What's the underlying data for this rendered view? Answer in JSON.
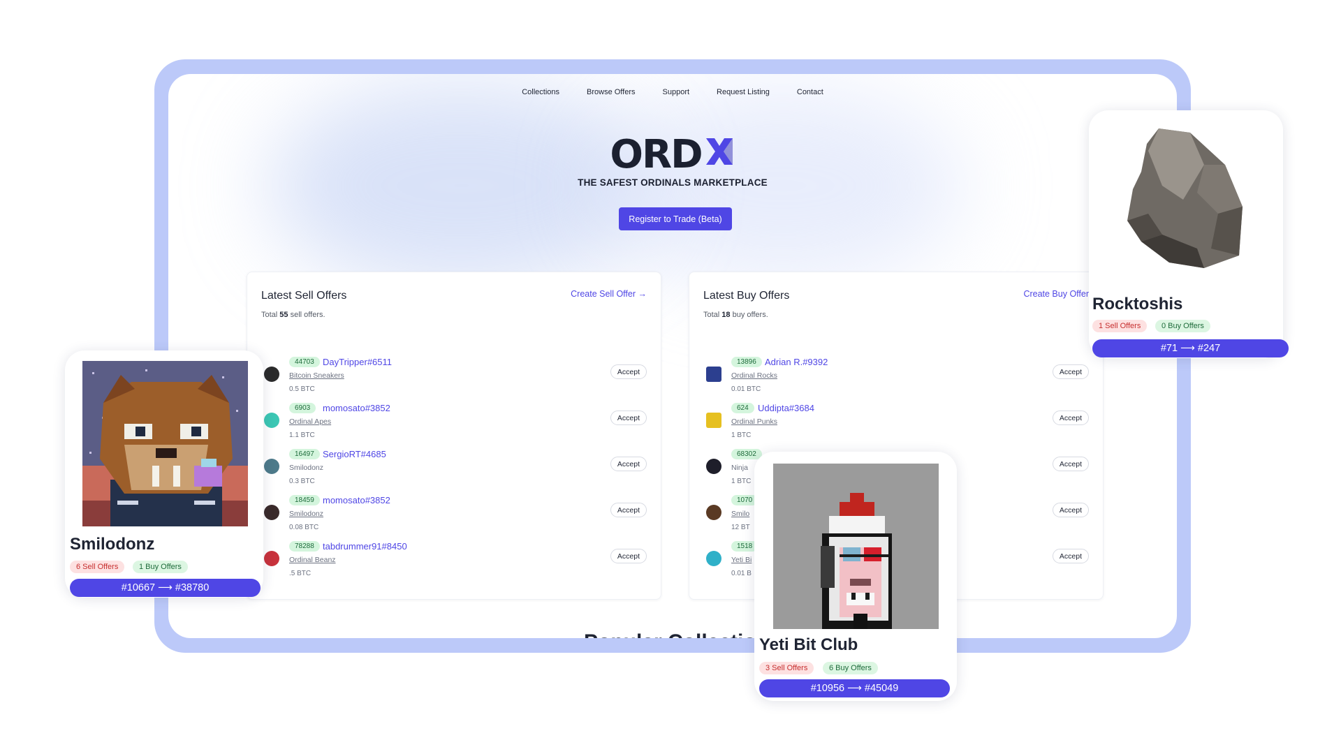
{
  "nav": {
    "items": [
      "Collections",
      "Browse Offers",
      "Support",
      "Request Listing",
      "Contact"
    ]
  },
  "hero": {
    "logo_text": "ORD",
    "tagline": "THE SAFEST ORDINALS MARKETPLACE",
    "cta_label": "Register to Trade (Beta)"
  },
  "sell": {
    "title": "Latest Sell Offers",
    "create_label": "Create Sell Offer →",
    "total_prefix": "Total ",
    "total_count": "55",
    "total_suffix": " sell offers.",
    "rows": [
      {
        "id": "44703",
        "name": "DayTripper#6511",
        "collection": "Bitcoin Sneakers",
        "price": "0.5 BTC",
        "accept": "Accept",
        "avatar_color": "#2b2b2b"
      },
      {
        "id": "6903",
        "name": "momosato#3852",
        "collection": "Ordinal Apes",
        "price": "1.1 BTC",
        "accept": "Accept",
        "avatar_color": "#3cc7b4"
      },
      {
        "id": "16497",
        "name": "SergioRT#4685",
        "collection": "Smilodonz",
        "price": "0.3 BTC",
        "accept": "Accept",
        "avatar_color": "#4d7a8a"
      },
      {
        "id": "18459",
        "name": "momosato#3852",
        "collection": "Smilodonz",
        "price": "0.08 BTC",
        "accept": "Accept",
        "avatar_color": "#3a2a2a"
      },
      {
        "id": "78288",
        "name": "tabdrummer91#8450",
        "collection": "Ordinal Beanz",
        "price": ".5 BTC",
        "accept": "Accept",
        "avatar_color": "#c8323c"
      }
    ]
  },
  "buy": {
    "title": "Latest Buy Offers",
    "create_label": "Create Buy Offer",
    "total_prefix": "Total ",
    "total_count": "18",
    "total_suffix": " buy offers.",
    "rows": [
      {
        "id": "13896",
        "name": "Adrian R.#9392",
        "collection": "Ordinal Rocks",
        "price": "0.01 BTC",
        "accept": "Accept",
        "avatar_color": "#2c3f8f"
      },
      {
        "id": "624",
        "name": "Uddipta#3684",
        "collection": "Ordinal Punks",
        "price": "1 BTC",
        "accept": "Accept",
        "avatar_color": "#e6c020"
      },
      {
        "id": "68302",
        "name": "",
        "collection": "Ninja",
        "price": "1 BTC",
        "accept": "Accept",
        "avatar_color": "#1e1e2a"
      },
      {
        "id": "1070",
        "name": "",
        "collection": "Smilo",
        "price": "12 BT",
        "accept": "Accept",
        "avatar_color": "#5a3a24"
      },
      {
        "id": "1518",
        "name": "",
        "collection": "Yeti Bi",
        "price": "0.01 B",
        "accept": "Accept",
        "avatar_color": "#2fb0c8"
      }
    ]
  },
  "bottom": {
    "title": "Popular Collections"
  },
  "cards": {
    "smilodonz": {
      "title": "Smilodonz",
      "sell_offers": "6 Sell Offers",
      "buy_offers": "1 Buy Offers",
      "range": "#10667 ⟶ #38780"
    },
    "yeti": {
      "title": "Yeti Bit Club",
      "sell_offers": "3 Sell Offers",
      "buy_offers": "6 Buy Offers",
      "range": "#10956 ⟶ #45049"
    },
    "rock": {
      "title": "Rocktoshis",
      "sell_offers": "1 Sell Offers",
      "buy_offers": "0 Buy Offers",
      "range": "#71 ⟶ #247"
    }
  },
  "colors": {
    "accent": "#4f46e5",
    "frame": "#bcc9f9",
    "tag_green_bg": "#d4f5dd",
    "pill_red_bg": "#fde1e1"
  }
}
